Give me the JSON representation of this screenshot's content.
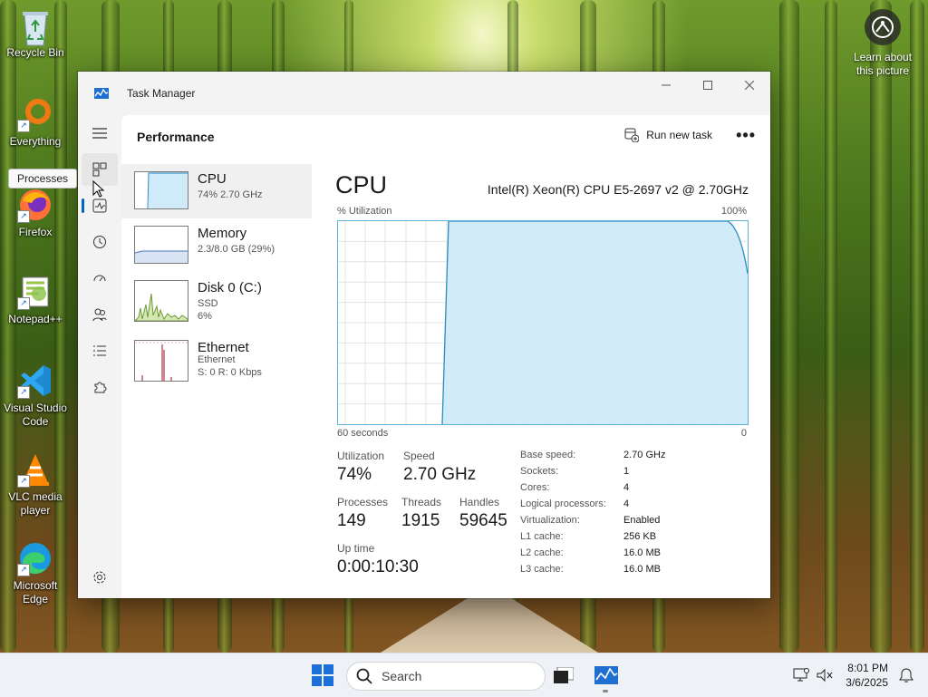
{
  "desktop": {
    "icons": [
      {
        "label": "Recycle Bin"
      },
      {
        "label": "Everything"
      },
      {
        "label": "Firefox"
      },
      {
        "label": "Notepad++"
      },
      {
        "label": "Visual Studio Code"
      },
      {
        "label": "VLC media player"
      },
      {
        "label": "Microsoft Edge"
      }
    ],
    "learn_label": "Learn about this picture",
    "tooltip": "Processes"
  },
  "window": {
    "title": "Task Manager",
    "page_title": "Performance",
    "run_task_label": "Run new task",
    "more_label": "•••"
  },
  "perf_list": [
    {
      "name": "CPU",
      "sub1": "74% 2.70 GHz",
      "sub2": "",
      "sub3": ""
    },
    {
      "name": "Memory",
      "sub1": "2.3/8.0 GB (29%)",
      "sub2": "",
      "sub3": ""
    },
    {
      "name": "Disk 0 (C:)",
      "sub1": "SSD",
      "sub2": "6%",
      "sub3": ""
    },
    {
      "name": "Ethernet",
      "sub1": "Ethernet",
      "sub2": "S: 0 R: 0 Kbps",
      "sub3": ""
    }
  ],
  "cpu": {
    "title": "CPU",
    "model": "Intel(R) Xeon(R) CPU E5-2697 v2 @ 2.70GHz",
    "graph_ylabel": "% Utilization",
    "graph_ymax": "100%",
    "graph_xlabel_left": "60 seconds",
    "graph_xlabel_right": "0",
    "stats": {
      "utilization_label": "Utilization",
      "utilization": "74%",
      "speed_label": "Speed",
      "speed": "2.70 GHz",
      "processes_label": "Processes",
      "processes": "149",
      "threads_label": "Threads",
      "threads": "1915",
      "handles_label": "Handles",
      "handles": "59645",
      "uptime_label": "Up time",
      "uptime": "0:00:10:30"
    },
    "specs": [
      {
        "k": "Base speed:",
        "v": "2.70 GHz"
      },
      {
        "k": "Sockets:",
        "v": "1"
      },
      {
        "k": "Cores:",
        "v": "4"
      },
      {
        "k": "Logical processors:",
        "v": "4"
      },
      {
        "k": "Virtualization:",
        "v": "Enabled"
      },
      {
        "k": "L1 cache:",
        "v": "256 KB"
      },
      {
        "k": "L2 cache:",
        "v": "16.0 MB"
      },
      {
        "k": "L3 cache:",
        "v": "16.0 MB"
      }
    ],
    "graph_fill": "#cfeaf8",
    "graph_line": "#2e8bc0"
  },
  "taskbar": {
    "search_placeholder": "Search",
    "time": "8:01 PM",
    "date": "3/6/2025"
  }
}
